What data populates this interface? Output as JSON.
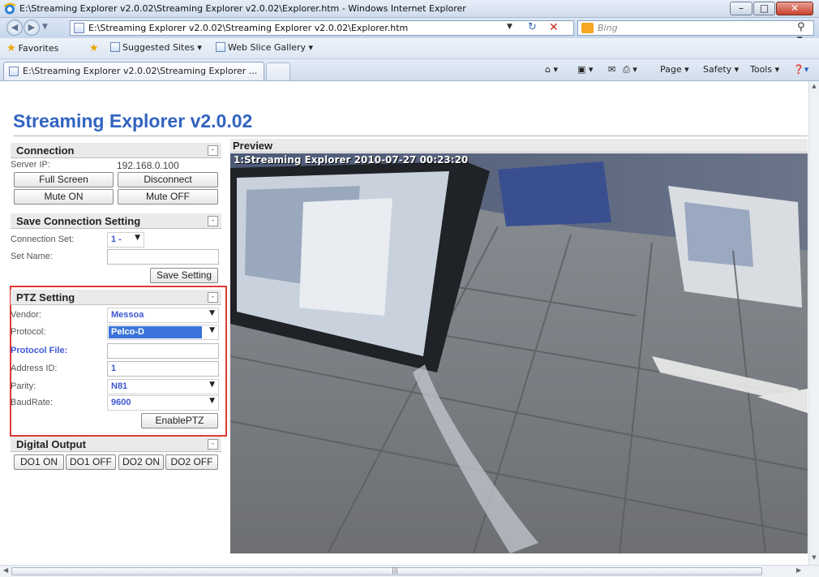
{
  "browser": {
    "window_title": "E:\\Streaming Explorer v2.0.02\\Streaming Explorer v2.0.02\\Explorer.htm - Windows Internet Explorer",
    "url": "E:\\Streaming Explorer v2.0.02\\Streaming Explorer v2.0.02\\Explorer.htm",
    "search_placeholder": "Bing",
    "favorites_label": "Favorites",
    "favorites": [
      "Suggested Sites ▾",
      "Web Slice Gallery ▾"
    ],
    "tab_title": "E:\\Streaming Explorer v2.0.02\\Streaming Explorer ...",
    "commands": [
      "Page ▾",
      "Safety ▾",
      "Tools ▾"
    ],
    "window_controls": {
      "minimize": "–",
      "maximize": "□",
      "close": "✕"
    }
  },
  "app": {
    "title": "Streaming Explorer v2.0.02",
    "connection": {
      "header": "Connection",
      "server_ip_label": "Server IP:",
      "server_ip": "192.168.0.100",
      "full_screen": "Full Screen",
      "disconnect": "Disconnect",
      "mute_on": "Mute ON",
      "mute_off": "Mute OFF"
    },
    "save_connection": {
      "header": "Save Connection Setting",
      "connection_set_label": "Connection Set:",
      "connection_set_value": "1 -",
      "set_name_label": "Set Name:",
      "set_name_value": "",
      "save_button": "Save Setting"
    },
    "ptz": {
      "header": "PTZ Setting",
      "vendor_label": "Vendor:",
      "vendor_value": "Messoa",
      "protocol_label": "Protocol:",
      "protocol_value": "Pelco-D",
      "protocol_file_label": "Protocol File:",
      "protocol_file_value": "",
      "address_label": "Address ID:",
      "address_value": "1",
      "parity_label": "Parity:",
      "parity_value": "N81",
      "baud_label": "BaudRate:",
      "baud_value": "9600",
      "enable_button": "EnablePTZ"
    },
    "digital_output": {
      "header": "Digital Output",
      "buttons": [
        "DO1 ON",
        "DO1 OFF",
        "DO2 ON",
        "DO2 OFF"
      ]
    },
    "preview": {
      "header": "Preview",
      "osd": "1:Streaming Explorer   2010-07-27 00:23:20"
    },
    "section_toggle": "-"
  }
}
